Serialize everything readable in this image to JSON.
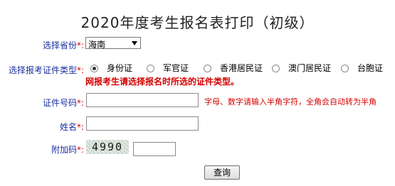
{
  "title": "2020年度考生报名表打印（初级）",
  "required_mark": "*:",
  "province": {
    "label": "选择省份",
    "value": "海南"
  },
  "id_type": {
    "label": "选择报考证件类型",
    "options": [
      "身份证",
      "军官证",
      "香港居民证",
      "澳门居民证",
      "台胞证"
    ],
    "selected_index": 0,
    "warning": "网报考生请选择报名时所选的证件类型。"
  },
  "id_number": {
    "label": "证件号码",
    "value": "",
    "hint": "字母、数字请输入半角字符，全角会自动转为半角"
  },
  "name": {
    "label": "姓名",
    "value": ""
  },
  "captcha": {
    "label": "附加码",
    "image_text": "4990",
    "value": ""
  },
  "submit_label": "查询"
}
